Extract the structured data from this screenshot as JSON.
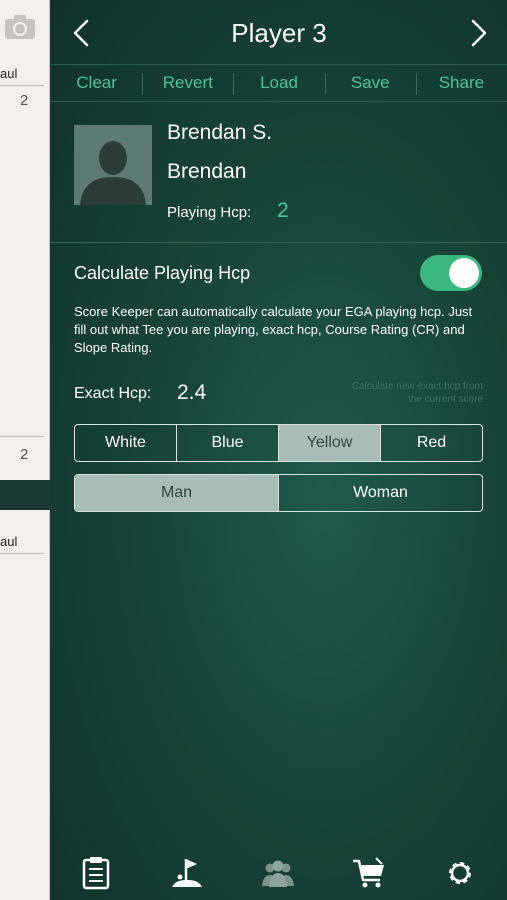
{
  "background_cards": {
    "top": {
      "label": "aul",
      "value_1": "2",
      "value_2": "2"
    },
    "bottom": {
      "label": "aul"
    }
  },
  "header": {
    "title": "Player 3",
    "prev_icon": "chevron-left-icon",
    "next_icon": "chevron-right-icon"
  },
  "toolbar": {
    "clear": "Clear",
    "revert": "Revert",
    "load": "Load",
    "save": "Save",
    "share": "Share"
  },
  "player": {
    "name": "Brendan S.",
    "nickname": "Brendan",
    "playing_hcp_label": "Playing Hcp:",
    "playing_hcp_value": "2"
  },
  "calculate": {
    "label": "Calculate Playing Hcp",
    "enabled": true,
    "description": "Score Keeper can automatically calculate your EGA playing hcp. Just fill out what Tee you are playing, exact hcp, Course Rating (CR) and Slope Rating.",
    "exact_hcp_label": "Exact Hcp:",
    "exact_hcp_value": "2.4",
    "faint_hint": "Calculate new exact hcp from the current score"
  },
  "tees": {
    "options": [
      "White",
      "Blue",
      "Yellow",
      "Red"
    ],
    "selected": "Yellow"
  },
  "gender": {
    "options": [
      "Man",
      "Woman"
    ],
    "selected": "Man"
  },
  "tabbar": {
    "items": [
      "scorecard-icon",
      "golf-green-icon",
      "players-icon",
      "shop-cart-icon",
      "settings-gear-icon"
    ],
    "active": "players-icon"
  },
  "colors": {
    "accent": "#4fc49a",
    "toggle_on": "#3bb87e",
    "segment_selected": "#a9bcb6"
  }
}
